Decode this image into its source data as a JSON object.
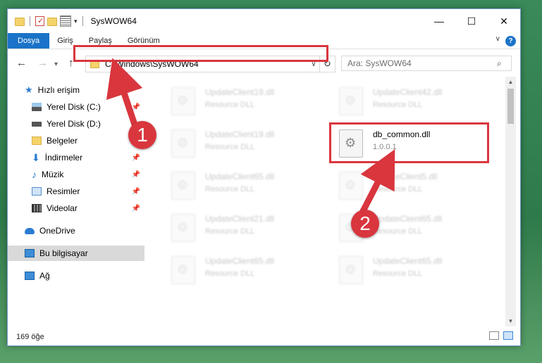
{
  "window": {
    "title": "SysWOW64",
    "controls": {
      "minimize": "—",
      "maximize": "☐",
      "close": "✕"
    }
  },
  "ribbon": {
    "tabs": [
      {
        "label": "Dosya"
      },
      {
        "label": "Giriş"
      },
      {
        "label": "Paylaş"
      },
      {
        "label": "Görünüm"
      }
    ],
    "help": "?"
  },
  "navigation": {
    "back": "←",
    "forward": "→",
    "up": "↑",
    "address": "C:\\Windows\\SysWOW64",
    "refresh": "↻",
    "search_placeholder": "Ara: SysWOW64"
  },
  "sidebar": {
    "items": [
      {
        "label": "Hızlı erişim"
      },
      {
        "label": "Yerel Disk (C:)"
      },
      {
        "label": "Yerel Disk (D:)"
      },
      {
        "label": "Belgeler"
      },
      {
        "label": "İndirmeler"
      },
      {
        "label": "Müzik"
      },
      {
        "label": "Resimler"
      },
      {
        "label": "Videolar"
      },
      {
        "label": "OneDrive"
      },
      {
        "label": "Bu bilgisayar"
      },
      {
        "label": "Ağ"
      }
    ]
  },
  "files": [
    {
      "name": "UpdateClient19.dll",
      "sub": "Resource DLL"
    },
    {
      "name": "UpdateClient42.dll",
      "sub": "Resource DLL"
    },
    {
      "name": "UpdateClient19.dll",
      "sub": "Resource DLL"
    },
    {
      "name": "db_common.dll",
      "sub": "1.0.0.1"
    },
    {
      "name": "UpdateClient65.dll",
      "sub": "Resource DLL"
    },
    {
      "name": "UpdateClient5.dll",
      "sub": "Resource DLL"
    },
    {
      "name": "UpdateClient21.dll",
      "sub": "Resource DLL"
    },
    {
      "name": "UpdateClient65.dll",
      "sub": "Resource DLL"
    },
    {
      "name": "UpdateClient65.dll",
      "sub": "Resource DLL"
    },
    {
      "name": "UpdateClient65.dll",
      "sub": "Resource DLL"
    }
  ],
  "status": {
    "count": "169 öğe"
  },
  "markers": {
    "one": "1",
    "two": "2"
  },
  "colors": {
    "accent": "#1a73c8",
    "highlight": "#d9363e",
    "selected": "#d9d9d9"
  }
}
